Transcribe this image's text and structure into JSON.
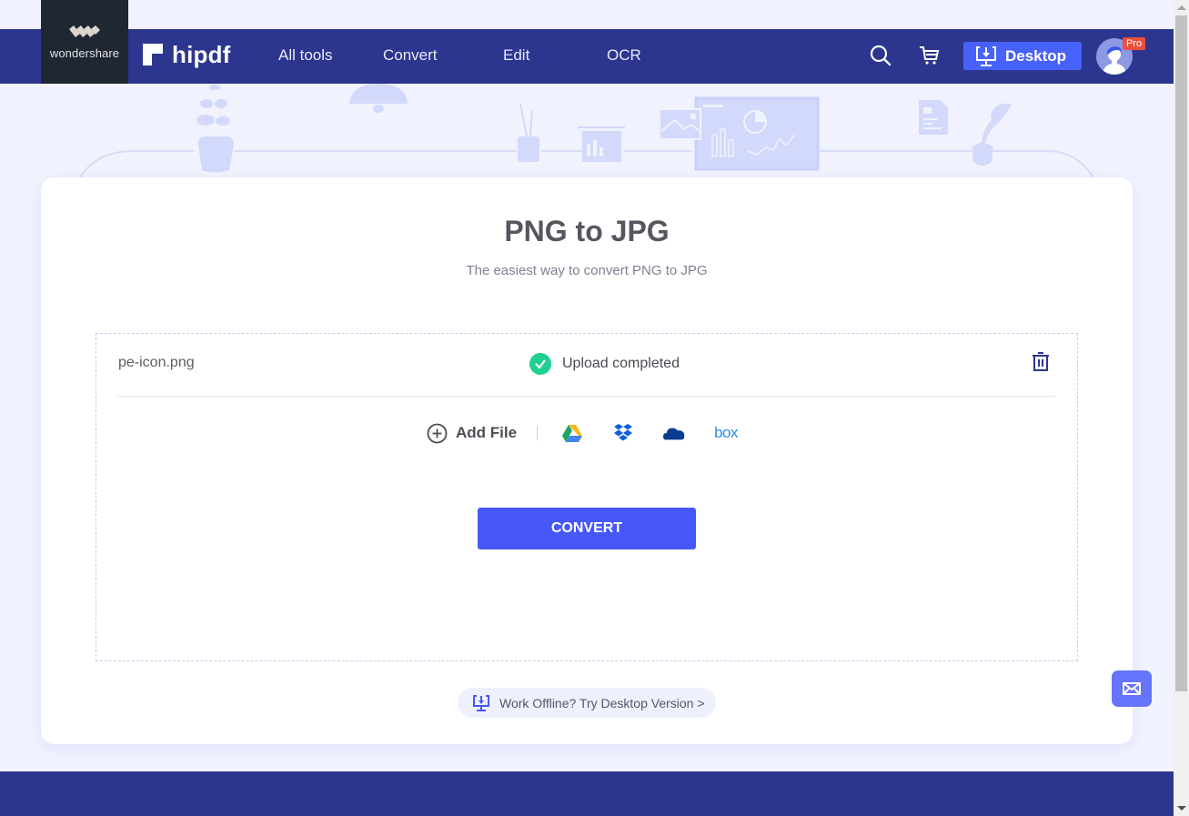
{
  "header": {
    "company": "wondershare",
    "brand": "hipdf",
    "nav": [
      {
        "label": "All tools"
      },
      {
        "label": "Convert"
      },
      {
        "label": "Edit"
      },
      {
        "label": "OCR"
      }
    ],
    "icons": [
      "search-icon",
      "cart-icon"
    ],
    "desktop_button": "Desktop",
    "pro_badge": "Pro"
  },
  "main": {
    "title": "PNG to JPG",
    "subtitle": "The easiest way to convert PNG to JPG",
    "file": {
      "name": "pe-icon.png",
      "status": "Upload completed"
    },
    "add_file_label": "Add File",
    "cloud_sources": [
      "google-drive",
      "dropbox",
      "onedrive",
      "box"
    ],
    "box_label": "box",
    "convert_label": "CONVERT",
    "offline_link": "Work Offline? Try Desktop Version >"
  },
  "colors": {
    "header_bg": "#2c368f",
    "accent": "#4658fa",
    "success": "#1fd190",
    "page_bg": "#f0f2fd",
    "pro_badge": "#ea4f3c"
  }
}
